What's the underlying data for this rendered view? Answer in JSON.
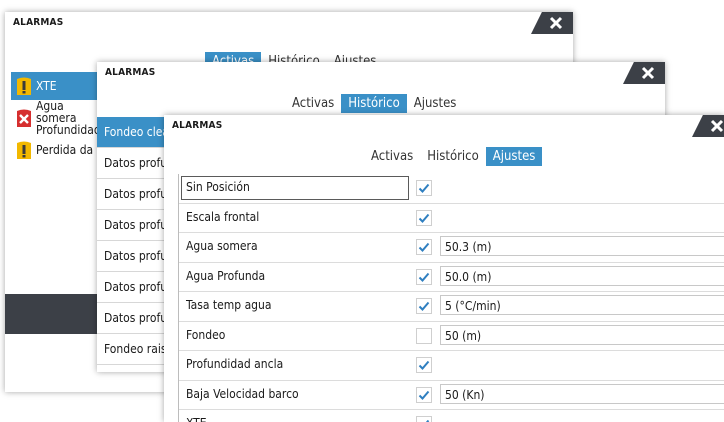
{
  "windows": {
    "w1": {
      "title": "ALARMAS",
      "tabs": [
        "Activas",
        "Histórico",
        "Ajustes"
      ],
      "alarms": [
        {
          "text": "XTE",
          "icon": "warning-icon"
        },
        {
          "text1": "Agua somera",
          "text2": "Profundidad",
          "icon": "alarm-error-icon"
        },
        {
          "text": "Perdida da",
          "icon": "warning-icon"
        }
      ]
    },
    "w2": {
      "title": "ALARMAS",
      "tabs": [
        "Activas",
        "Histórico",
        "Ajustes"
      ],
      "history": [
        "Fondeo clear",
        "Datos profu",
        "Datos profu",
        "Datos profu",
        "Datos profu",
        "Datos profu",
        "Datos profu",
        "Fondeo rais"
      ]
    },
    "w3": {
      "title": "ALARMAS",
      "tabs": [
        "Activas",
        "Histórico",
        "Ajustes"
      ],
      "settings": [
        {
          "label": "Sin Posición",
          "checked": true,
          "value": ""
        },
        {
          "label": "Escala frontal",
          "checked": true,
          "value": ""
        },
        {
          "label": "Agua somera",
          "checked": true,
          "value": "50.3 (m)"
        },
        {
          "label": "Agua Profunda",
          "checked": true,
          "value": "50.0 (m)"
        },
        {
          "label": "Tasa temp agua",
          "checked": true,
          "value": "5 (°C/min)"
        },
        {
          "label": "Fondeo",
          "checked": false,
          "value": "50 (m)"
        },
        {
          "label": "Profundidad ancla",
          "checked": true,
          "value": ""
        },
        {
          "label": "Baja Velocidad barco",
          "checked": true,
          "value": "50 (Kn)"
        },
        {
          "label": "XTE",
          "checked": true,
          "value": ""
        }
      ]
    }
  },
  "colors": {
    "accent": "#3a90c7",
    "dark": "#3c4047",
    "warning": "#f2b800",
    "error": "#d62f2f"
  }
}
